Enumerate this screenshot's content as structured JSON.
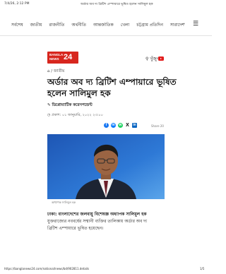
{
  "print_header": {
    "date": "7/4/26, 2:12 PM",
    "title": "অর্ডার অব দ্য ব্রিটিশ এম্পায়ারে ভূষিত হলেন সালিমুল হক"
  },
  "nav": {
    "items": [
      "সর্বশেষ",
      "জাতীয়",
      "রাজনীতি",
      "অর্থনীতি",
      "আন্তর্জাতিক",
      "খেলা",
      "চট্টগ্রাম প্রতিদিন",
      "সারাদেশ"
    ],
    "more": "+",
    "menu_icon": "hamburger-icon"
  },
  "logo": {
    "line1": "BANGLA",
    "line2": "NEWS",
    "number": "24"
  },
  "search": {
    "label": "খুঁজুন",
    "icon": "search-icon"
  },
  "social": {
    "icon": "youtube-icon",
    "color": "#e21d1d"
  },
  "breadcrumb": {
    "home_icon": "home-icon",
    "separator": "/",
    "section": "জাতীয়"
  },
  "article": {
    "headline_line1": "অর্ডার অব দ্য ব্রিটিশ এম্পায়ারে ভূষিত",
    "headline_line2": "হলেন সালিমুল হক",
    "author": "ডিপ্লোম্যাটিক করেসপন্ডেন্ট",
    "published": "প্রকাশ: ০১ জানুয়ারি, ২০২২ ২৩:০০",
    "share_label": "Share 20",
    "photo_caption": "অধ্যাপক সালিমুল হক",
    "body_lines": [
      "ঢাকা: বাংলাদেশের জলবায়ু বিশেষজ্ঞ অধ্যাপক সালিমুল হক",
      "যুক্তরাজ্যের নববর্ষের সম্মানী ব্যক্তির তালিকায় অর্ডার অব দ্য",
      "ব্রিটিশ এম্পায়ারে ভূষিত হয়েছেন।"
    ]
  },
  "footer": {
    "url": "https://banglanews24.com/national/news/bd/902811.details",
    "page": "1/5"
  },
  "colors": {
    "brand": "#d7261e",
    "facebook": "#1877f2",
    "whatsapp": "#25d366"
  }
}
